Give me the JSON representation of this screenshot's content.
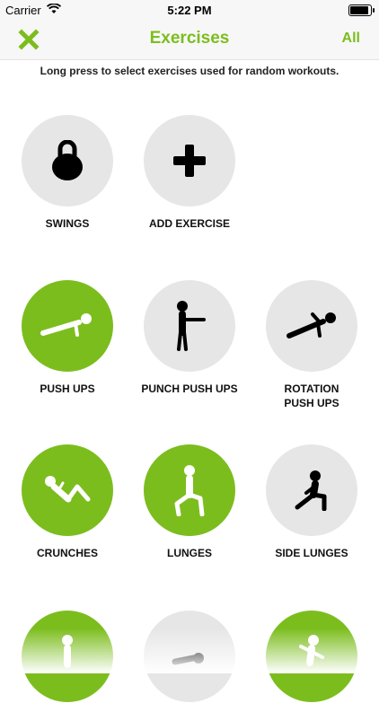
{
  "status": {
    "carrier": "Carrier",
    "time": "5:22 PM"
  },
  "nav": {
    "title": "Exercises",
    "all_label": "All",
    "accent": "#7cbd1e"
  },
  "hint": "Long press to select exercises used for random workouts.",
  "exercises": [
    {
      "label": "SWINGS",
      "icon": "kettlebell-icon",
      "selected": false
    },
    {
      "label": "ADD EXERCISE",
      "icon": "plus-icon",
      "selected": false
    },
    {
      "label": "PUSH UPS",
      "icon": "push-up-icon",
      "selected": true
    },
    {
      "label": "PUNCH PUSH UPS",
      "icon": "punch-icon",
      "selected": false
    },
    {
      "label": "ROTATION\nPUSH UPS",
      "icon": "rotation-push-up-icon",
      "selected": false
    },
    {
      "label": "CRUNCHES",
      "icon": "crunch-icon",
      "selected": true
    },
    {
      "label": "LUNGES",
      "icon": "lunge-icon",
      "selected": true
    },
    {
      "label": "SIDE LUNGES",
      "icon": "side-lunge-icon",
      "selected": false
    },
    {
      "label": "",
      "icon": "squat-icon",
      "selected": true
    },
    {
      "label": "",
      "icon": "burpee-icon",
      "selected": false
    },
    {
      "label": "",
      "icon": "jumping-icon",
      "selected": true
    }
  ]
}
